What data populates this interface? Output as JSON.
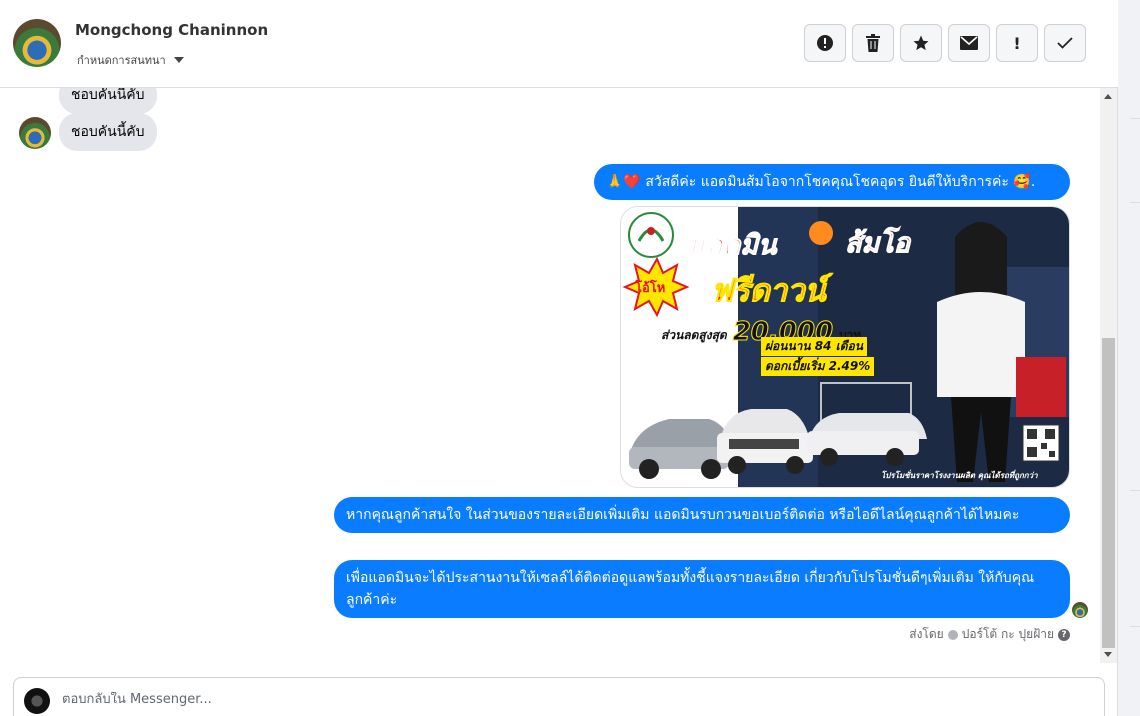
{
  "header": {
    "name": "Mongchong Chaninnon",
    "subtitle": "กำหนดการสนทนา",
    "toolbar": [
      {
        "icon": "alert-circle-icon",
        "glyph": "!"
      },
      {
        "icon": "trash-icon",
        "glyph": ""
      },
      {
        "icon": "star-icon",
        "glyph": "★"
      },
      {
        "icon": "envelope-icon",
        "glyph": "✉"
      },
      {
        "icon": "exclamation-icon",
        "glyph": "!"
      },
      {
        "icon": "check-icon",
        "glyph": "✓"
      }
    ]
  },
  "messages": {
    "incoming_prev": "ชอบคันนี้คับ",
    "incoming": "ชอบคันนี้คับ",
    "out_greeting": "🙏❤️ สวัสดีค่ะ แอดมินส้มโอจากโชคคุณโชคอุดร ยินดีให้บริการค่ะ 🥰.",
    "out_details": "หากคุณลูกค้าสนใจ ในส่วนของรายละเอียดเพิ่มเติม แอดมินรบกวนขอเบอร์ติดต่อ หรือไอดีไลน์คุณลูกค้าได้ไหมคะ",
    "out_coordinate": "เพื่อแอดมินจะได้ประสานงานให้เซลล์ได้ติดต่อดูแลพร้อมทั้งชี้แจงรายละเอียด เกี่ยวกับโปรโมชั่นดีๆเพิ่มเติม ให้กับคุณลูกค้าค่ะ",
    "sent_by_label": "ส่งโดย",
    "sent_by_name": "ปอร์โต้ กะ ปุยฝ้าย",
    "help": "?"
  },
  "promo": {
    "title_1": "แอดมิน",
    "title_2": "ส้มโอ",
    "badge": "โอ้โห",
    "headline": "ฟรีดาวน์",
    "discount_label": "ส่วนลดสูงสุด",
    "discount_value": "20,000",
    "discount_unit": "บาท",
    "installment": "ผ่อนนาน 84 เดือน",
    "interest": "ดอกเบี้ยเริ่ม 2.49%",
    "footer": "โปรโมชั่นราคาโรงงานผลิต คุณได้รถที่ถูกกว่า"
  },
  "composer": {
    "placeholder": "ตอบกลับใน Messenger..."
  },
  "colors": {
    "outgoing": "#0a7cff",
    "incoming": "#e4e6eb",
    "promo_red": "#e8141c",
    "promo_yellow": "#ffe600"
  }
}
